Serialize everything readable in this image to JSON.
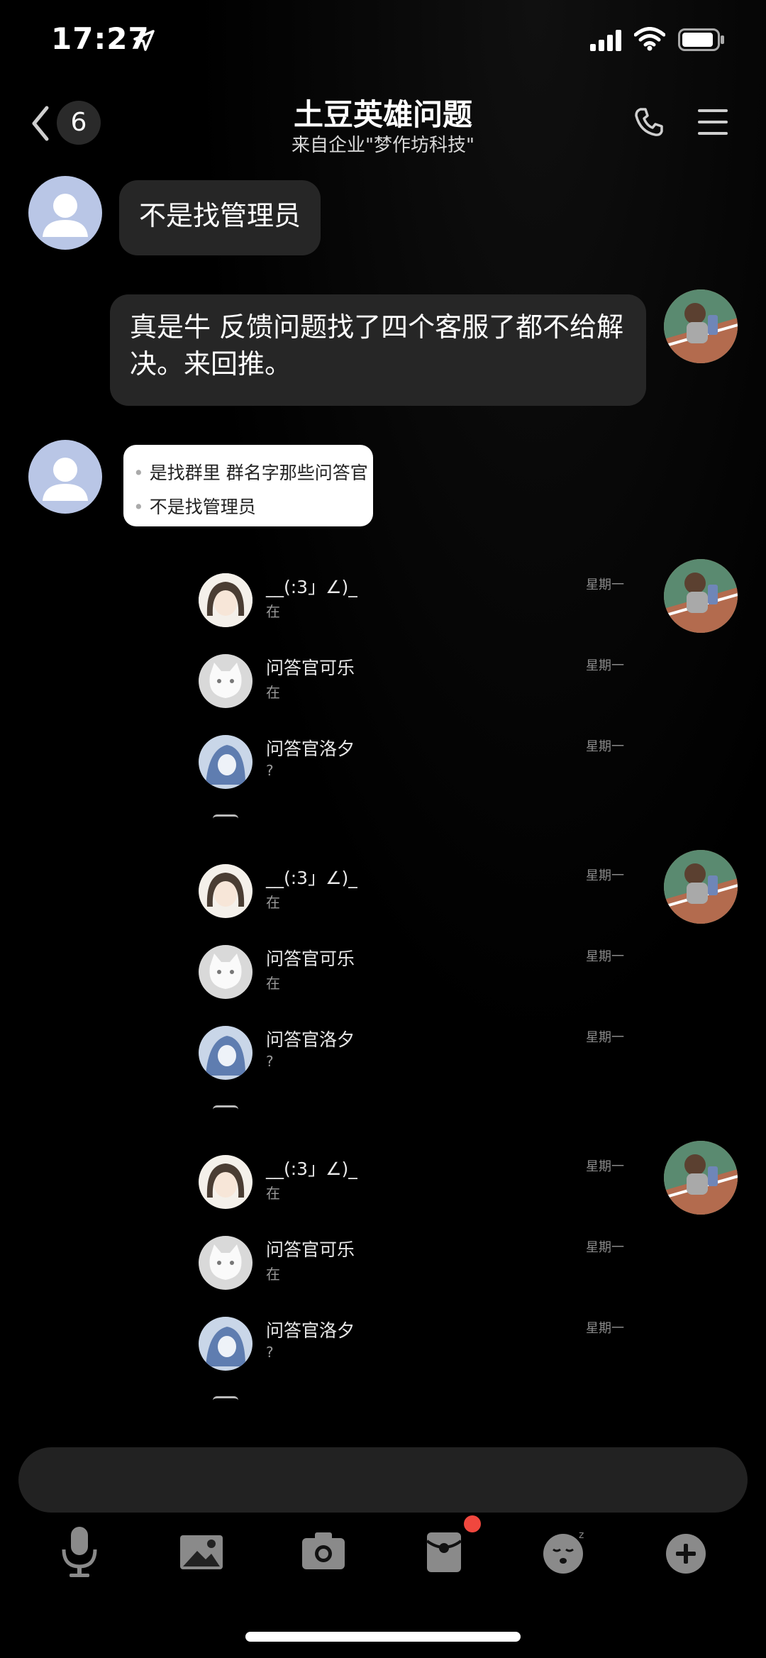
{
  "status_bar": {
    "time": "17:27",
    "icons": [
      "location-arrow-icon",
      "cellular-signal-icon",
      "wifi-icon",
      "battery-icon"
    ]
  },
  "header": {
    "back_count": "6",
    "title": "土豆英雄问题",
    "subtitle": "来自企业\"梦作坊科技\"",
    "icons": [
      "back-chevron-icon",
      "phone-icon",
      "menu-icon"
    ]
  },
  "messages": [
    {
      "sender": "other",
      "text": "不是找管理员"
    },
    {
      "sender": "self",
      "text": "真是牛  反馈问题找了四个客服了都不给解决。来回推。"
    }
  ],
  "quote_card": {
    "lines": [
      "是找群里 群名字那些问答官",
      "不是找管理员"
    ]
  },
  "forwarded_blocks": [
    {
      "items": [
        {
          "name": "__(:3」∠)_",
          "msg": "在",
          "time": "星期一"
        },
        {
          "name": "问答官可乐",
          "msg": "在",
          "time": "星期一"
        },
        {
          "name": "问答官洛夕",
          "msg": "?",
          "time": "星期一"
        }
      ]
    },
    {
      "items": [
        {
          "name": "__(:3」∠)_",
          "msg": "在",
          "time": "星期一"
        },
        {
          "name": "问答官可乐",
          "msg": "在",
          "time": "星期一"
        },
        {
          "name": "问答官洛夕",
          "msg": "?",
          "time": "星期一"
        }
      ]
    },
    {
      "items": [
        {
          "name": "__(:3」∠)_",
          "msg": "在",
          "time": "星期一"
        },
        {
          "name": "问答官可乐",
          "msg": "在",
          "time": "星期一"
        },
        {
          "name": "问答官洛夕",
          "msg": "?",
          "time": "星期一"
        }
      ]
    }
  ],
  "input": {
    "placeholder": ""
  },
  "toolbar": {
    "icons": [
      "microphone-icon",
      "image-icon",
      "camera-icon",
      "red-packet-icon",
      "emoji-icon",
      "plus-icon"
    ],
    "notification_dot_color": "#f0473e"
  },
  "colors": {
    "background": "#000000",
    "bubble": "#262626",
    "default_avatar": "#b9c6e6"
  }
}
